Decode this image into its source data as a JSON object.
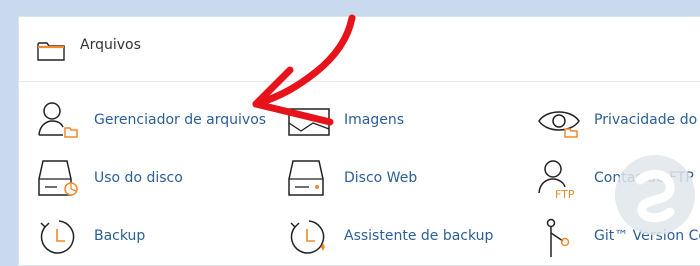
{
  "section": {
    "title": "Arquivos"
  },
  "items": [
    {
      "label": "Gerenciador de arquivos",
      "icon": "file-manager-icon"
    },
    {
      "label": "Imagens",
      "icon": "images-icon"
    },
    {
      "label": "Privacidade do d",
      "icon": "privacy-eye-icon"
    },
    {
      "label": "Uso do disco",
      "icon": "disk-usage-icon"
    },
    {
      "label": "Disco Web",
      "icon": "web-disk-icon"
    },
    {
      "label": "Contas de FTP",
      "icon": "ftp-accounts-icon"
    },
    {
      "label": "Backup",
      "icon": "backup-clock-icon"
    },
    {
      "label": "Assistente de backup",
      "icon": "backup-wizard-icon"
    },
    {
      "label": "Git™ Version Con",
      "icon": "git-branch-icon"
    }
  ],
  "icon_badges": {
    "ftp": "FTP"
  },
  "colors": {
    "link": "#2a5f97",
    "accent_orange": "#f28a2e",
    "arrow_red": "#e8121b",
    "page_background": "#c9d9ee"
  }
}
